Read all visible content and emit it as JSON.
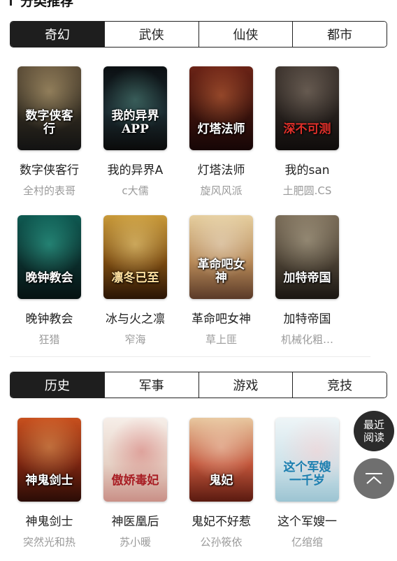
{
  "section": {
    "title": "分类推荐"
  },
  "tabs1": [
    "奇幻",
    "武侠",
    "仙侠",
    "都市"
  ],
  "books1": [
    {
      "title": "数字侠客行",
      "author": "全村的表哥",
      "cover_text": "数字侠客行",
      "cover_bg": "#3a3426"
    },
    {
      "title": "我的异界A",
      "author": "c大儒",
      "cover_text": "我的异界APP",
      "cover_bg": "#0d1418"
    },
    {
      "title": "灯塔法师",
      "author": "旋风风派",
      "cover_text": "灯塔法师",
      "cover_bg": "#4a1a12"
    },
    {
      "title": "我的san",
      "author": "土肥圆.CS",
      "cover_text": "深不可测",
      "cover_bg": "#2d2521"
    },
    {
      "title": "晚钟教会",
      "author": "狂猎",
      "cover_text": "晚钟教会",
      "cover_bg": "#0f3a38"
    },
    {
      "title": "冰与火之凛",
      "author": "窄海",
      "cover_text": "凛冬已至",
      "cover_bg": "#8a5a14"
    },
    {
      "title": "革命吧女神",
      "author": "草上匪",
      "cover_text": "革命吧女神",
      "cover_bg": "#c9a774"
    },
    {
      "title": "加特帝国",
      "author": "机械化粗…",
      "cover_text": "加特帝国",
      "cover_bg": "#4a4033"
    }
  ],
  "tabs2": [
    "历史",
    "军事",
    "游戏",
    "竞技"
  ],
  "books2": [
    {
      "title": "神鬼剑士",
      "author": "突然光和热",
      "cover_text": "神鬼剑士",
      "cover_bg": "#a33a1a"
    },
    {
      "title": "神医凰后",
      "author": "苏小暖",
      "cover_text": "傲娇毒妃",
      "cover_bg": "#efe4dc"
    },
    {
      "title": "鬼妃不好惹",
      "author": "公孙筱依",
      "cover_text": "鬼妃",
      "cover_bg": "#b9472e"
    },
    {
      "title": "这个军嫂一",
      "author": "亿绾绾",
      "cover_text": "这个军嫂一千岁",
      "cover_bg": "#cfe3ea"
    }
  ],
  "floating": {
    "recent_line1": "最近",
    "recent_line2": "阅读",
    "totop_icon": "chevron-up-icon"
  }
}
